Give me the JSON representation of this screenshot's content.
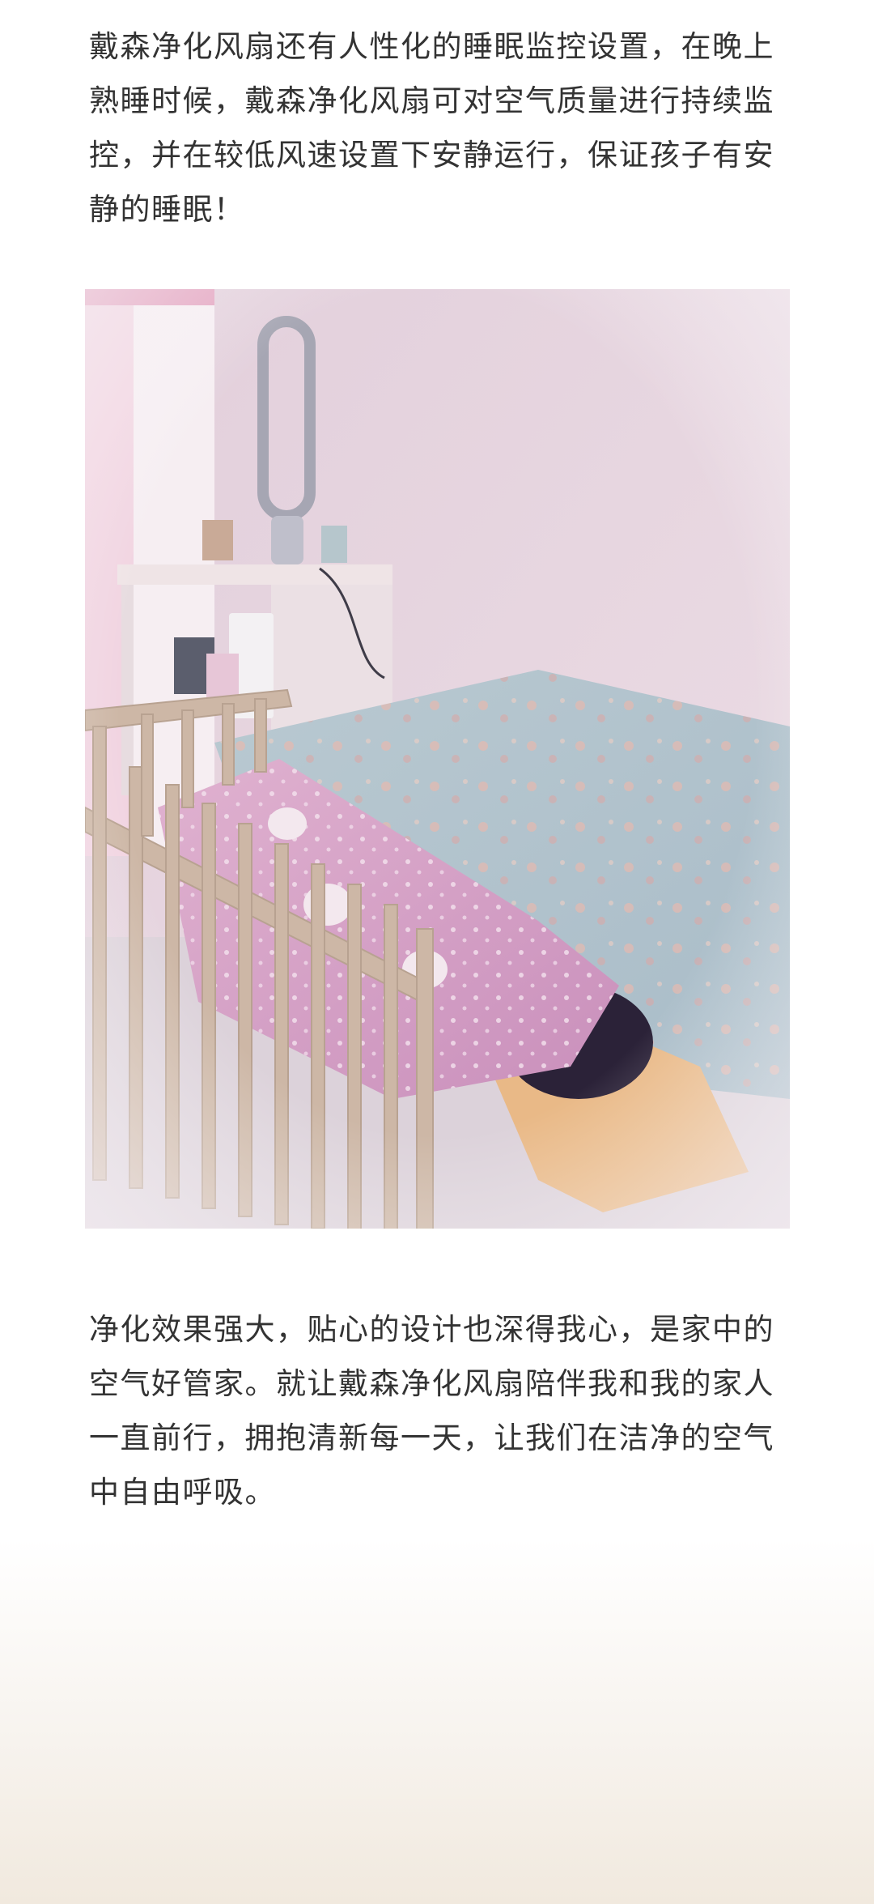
{
  "article": {
    "paragraph_1": "戴森净化风扇还有人性化的睡眠监控设置，在晚上熟睡时候，戴森净化风扇可对空气质量进行持续监控，并在较低风速设置下安静运行，保证孩子有安静的睡眠！",
    "paragraph_2": "净化效果强大，贴心的设计也深得我心，是家中的空气好管家。就让戴森净化风扇陪伴我和我的家人一直前行，拥抱清新每一天，让我们在洁净的空气中自由呼吸。"
  },
  "colors": {
    "text": "#333333",
    "wall": "#e6d6df",
    "bedsheet": "#b3c4cc",
    "blanket_pink": "#d9a4c9",
    "crib_wood": "#c8b3a3",
    "footer_gradient": "#f1e9de"
  }
}
